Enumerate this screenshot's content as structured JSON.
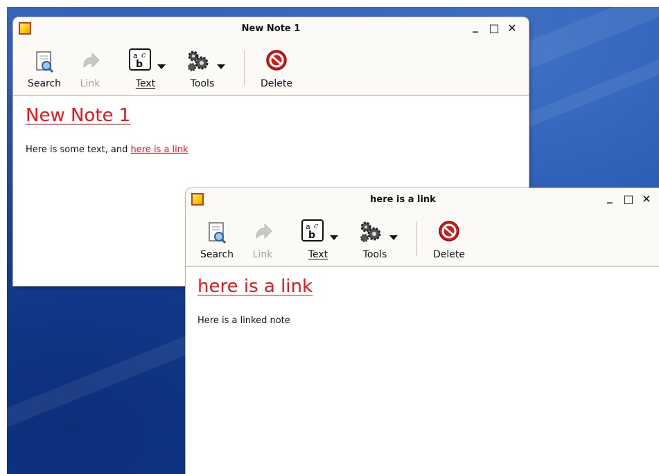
{
  "windows": [
    {
      "title": "New Note 1",
      "toolbar": {
        "search": "Search",
        "link": "Link",
        "text": "Text",
        "tools": "Tools",
        "delete": "Delete"
      },
      "note_title": "New Note 1",
      "body_text": "Here is some text, and ",
      "body_link": "here is a link"
    },
    {
      "title": "here is a link",
      "toolbar": {
        "search": "Search",
        "link": "Link",
        "text": "Text",
        "tools": "Tools",
        "delete": "Delete"
      },
      "note_title": "here is a link",
      "body_text": "Here is a linked note"
    }
  ],
  "window_controls": {
    "minimize": "_",
    "maximize": "□",
    "close": "✕"
  },
  "colors": {
    "link": "#e8141a",
    "desktop": "#1a4aa5",
    "chrome": "#fcfaf6"
  }
}
